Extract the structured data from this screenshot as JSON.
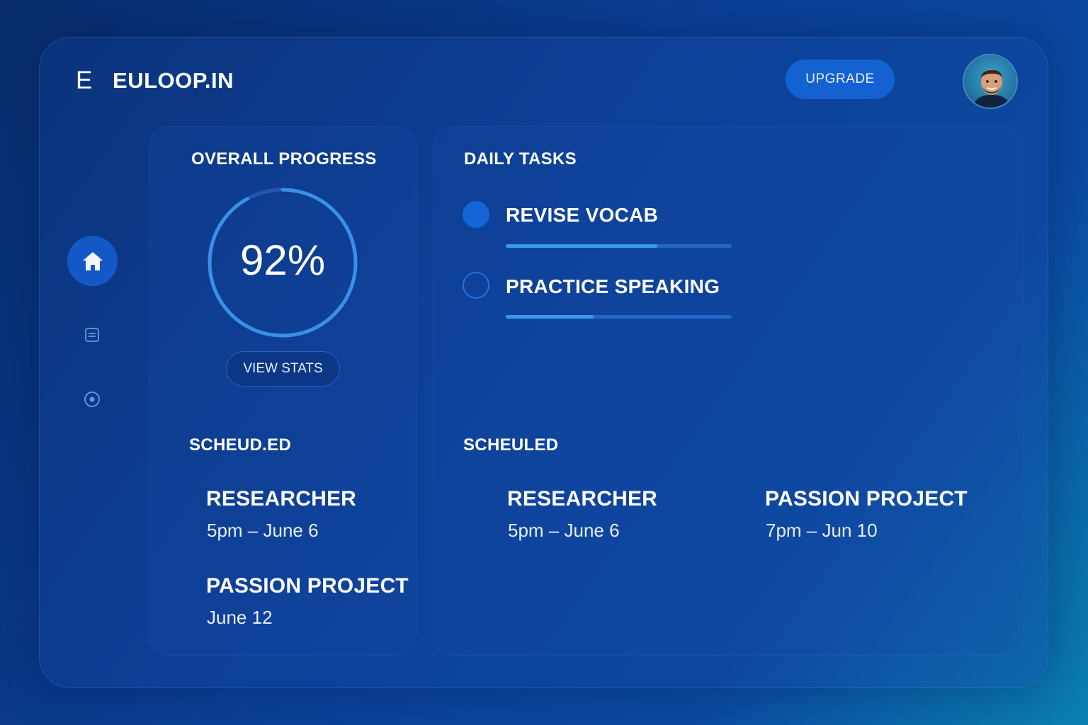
{
  "header": {
    "brand_mark": "E",
    "brand_name": "EULOOP.IN",
    "upgrade_label": "UPGRADE",
    "avatar_icon": "user-avatar-photo"
  },
  "sidebar": {
    "items": [
      {
        "icon": "home-icon",
        "active": true
      },
      {
        "icon": "list-icon",
        "active": false
      },
      {
        "icon": "target-icon",
        "active": false
      }
    ]
  },
  "progress": {
    "title": "OVERALL PROGRESS",
    "percent": 92,
    "percent_label": "92%",
    "button_label": "VIEW STATS"
  },
  "tasks": {
    "title": "DAILY TASKS",
    "items": [
      {
        "label": "REVISE VOCAB",
        "completed": true,
        "progress": 0.67
      },
      {
        "label": "PRACTICE SPEAKING",
        "completed": false,
        "progress": 0.39
      }
    ]
  },
  "schedule_left": {
    "title": "SCHEUD.ED",
    "events": [
      {
        "title": "RESEARCHER",
        "time": "5pm – June 6"
      },
      {
        "title": "PASSION PROJECT",
        "time": "June 12"
      }
    ]
  },
  "schedule_right": {
    "title": "SCHEULED",
    "events": [
      {
        "title": "RESEARCHER",
        "time": "5pm – June 6"
      },
      {
        "title": "PASSION PROJECT",
        "time": "7pm – Jun 10"
      }
    ]
  },
  "colors": {
    "accent": "#1461d2",
    "ring": "#3a8fe8",
    "background": "#0a3f94"
  }
}
